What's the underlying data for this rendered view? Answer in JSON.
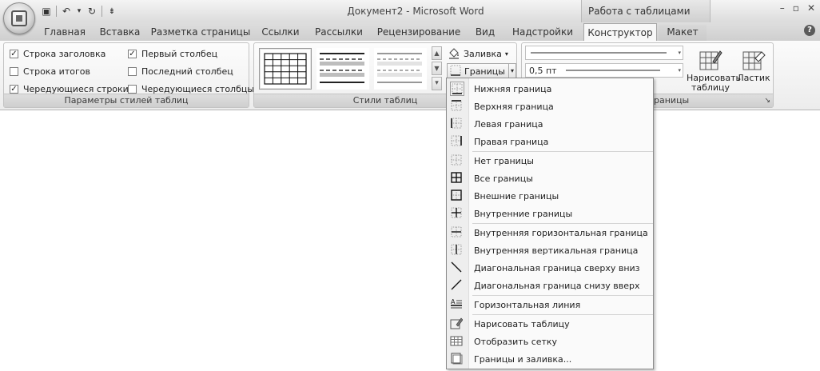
{
  "window": {
    "title": "Документ2 - Microsoft Word",
    "context_header": "Работа с таблицами",
    "controls": {
      "minimize": "–",
      "restore": "▫",
      "close": "✕"
    },
    "help": "?"
  },
  "quick_access": {
    "icons": [
      "save-icon",
      "undo-icon",
      "redo-icon",
      "customize-icon"
    ],
    "glyphs": {
      "save": "▣",
      "undo": "↶",
      "dropdown": "▾",
      "redo": "↻",
      "customize": "⇟"
    }
  },
  "tabs": [
    {
      "label": "Главная",
      "active": false
    },
    {
      "label": "Вставка",
      "active": false
    },
    {
      "label": "Разметка страницы",
      "active": false
    },
    {
      "label": "Ссылки",
      "active": false
    },
    {
      "label": "Рассылки",
      "active": false
    },
    {
      "label": "Рецензирование",
      "active": false
    },
    {
      "label": "Вид",
      "active": false
    },
    {
      "label": "Надстройки",
      "active": false
    },
    {
      "label": "Конструктор",
      "active": true
    },
    {
      "label": "Макет",
      "active": false
    }
  ],
  "ribbon": {
    "style_options": {
      "label": "Параметры стилей таблиц",
      "checkboxes": [
        {
          "label": "Строка заголовка",
          "checked": true
        },
        {
          "label": "Строка итогов",
          "checked": false
        },
        {
          "label": "Чередующиеся строки",
          "checked": true
        },
        {
          "label": "Первый столбец",
          "checked": true
        },
        {
          "label": "Последний столбец",
          "checked": false
        },
        {
          "label": "Чередующиеся столбцы",
          "checked": false
        }
      ],
      "check_mark": "✓"
    },
    "table_styles": {
      "label": "Стили таблиц",
      "scroll": {
        "up": "▲",
        "down": "▼",
        "more": "▾"
      }
    },
    "shading": {
      "label": "Заливка",
      "arrow": "▾"
    },
    "borders": {
      "label": "Границы",
      "arrow": "▾"
    },
    "draw_borders": {
      "label_visible": "раницы",
      "weight": "0,5 пт",
      "draw_table": "Нарисовать таблицу",
      "eraser": "Ластик",
      "launcher": "↘"
    }
  },
  "menu": {
    "items": [
      {
        "label": "Нижняя граница",
        "icon": "bottom-border-icon",
        "selected": true
      },
      {
        "label": "Верхняя граница",
        "icon": "top-border-icon"
      },
      {
        "label": "Левая граница",
        "icon": "left-border-icon"
      },
      {
        "label": "Правая граница",
        "icon": "right-border-icon"
      },
      {
        "label": "Нет границы",
        "icon": "no-border-icon"
      },
      {
        "label": "Все границы",
        "icon": "all-borders-icon"
      },
      {
        "label": "Внешние границы",
        "icon": "outside-borders-icon"
      },
      {
        "label": "Внутренние границы",
        "icon": "inside-borders-icon"
      },
      {
        "label": "Внутренняя горизонтальная граница",
        "icon": "inside-horizontal-border-icon"
      },
      {
        "label": "Внутренняя вертикальная граница",
        "icon": "inside-vertical-border-icon"
      },
      {
        "label": "Диагональная граница сверху вниз",
        "icon": "diagonal-down-border-icon"
      },
      {
        "label": "Диагональная граница снизу вверх",
        "icon": "diagonal-up-border-icon"
      },
      {
        "label": "Горизонтальная линия",
        "icon": "horizontal-line-icon"
      },
      {
        "label": "Нарисовать таблицу",
        "icon": "draw-table-icon"
      },
      {
        "label": "Отобразить сетку",
        "icon": "view-gridlines-icon"
      },
      {
        "label": "Границы и заливка...",
        "icon": "borders-and-shading-icon"
      }
    ]
  }
}
